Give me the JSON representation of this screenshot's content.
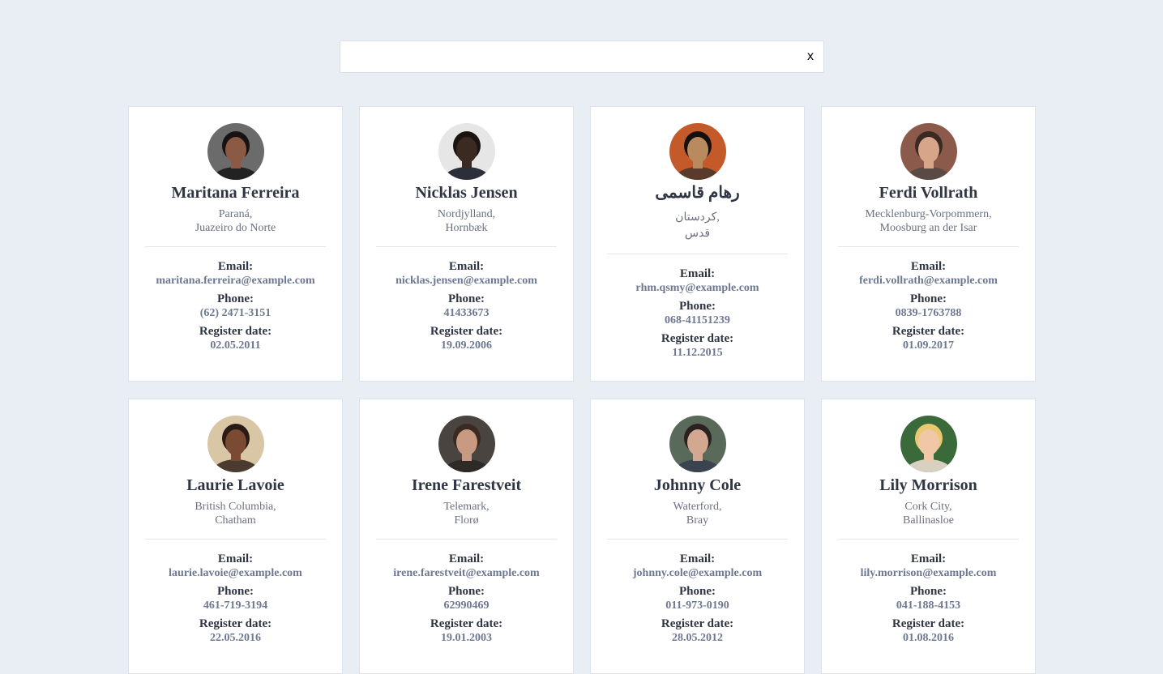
{
  "search": {
    "placeholder": "",
    "value": "",
    "clear_label": "x"
  },
  "labels": {
    "email": "Email:",
    "phone": "Phone:",
    "register": "Register date:"
  },
  "users": [
    {
      "name": "Maritana Ferreira",
      "state": "Paraná,",
      "city": "Juazeiro do Norte",
      "email": "maritana.ferreira@example.com",
      "phone": "(62) 2471-3151",
      "registered": "02.05.2011",
      "avatar": {
        "bg": "#6b6b6b",
        "skin": "#8a5a44",
        "hair": "#1a1212",
        "shirt": "#222222"
      }
    },
    {
      "name": "Nicklas Jensen",
      "state": "Nordjylland,",
      "city": "Hornbæk",
      "email": "nicklas.jensen@example.com",
      "phone": "41433673",
      "registered": "19.09.2006",
      "avatar": {
        "bg": "#e6e6e6",
        "skin": "#3b2a22",
        "hair": "#1c1410",
        "shirt": "#2a2f3a"
      }
    },
    {
      "name": "رهام قاسمی",
      "state": "کردستان,",
      "city": "قدس",
      "email": "rhm.qsmy@example.com",
      "phone": "068-41151239",
      "registered": "11.12.2015",
      "avatar": {
        "bg": "#c45a2a",
        "skin": "#b98a5e",
        "hair": "#141010",
        "shirt": "#5a3a2a"
      }
    },
    {
      "name": "Ferdi Vollrath",
      "state": "Mecklenburg-Vorpommern,",
      "city": "Moosburg an der Isar",
      "email": "ferdi.vollrath@example.com",
      "phone": "0839-1763788",
      "registered": "01.09.2017",
      "avatar": {
        "bg": "#8c5a4a",
        "skin": "#d6a58a",
        "hair": "#3a2a22",
        "shirt": "#5a4a44"
      }
    },
    {
      "name": "Laurie Lavoie",
      "state": "British Columbia,",
      "city": "Chatham",
      "email": "laurie.lavoie@example.com",
      "phone": "461-719-3194",
      "registered": "22.05.2016",
      "avatar": {
        "bg": "#d9c6a4",
        "skin": "#7a4a32",
        "hair": "#2a1a14",
        "shirt": "#4a3a30"
      }
    },
    {
      "name": "Irene Farestveit",
      "state": "Telemark,",
      "city": "Florø",
      "email": "irene.farestveit@example.com",
      "phone": "62990469",
      "registered": "19.01.2003",
      "avatar": {
        "bg": "#4a4440",
        "skin": "#c89a82",
        "hair": "#3a2a22",
        "shirt": "#2e2a28"
      }
    },
    {
      "name": "Johnny Cole",
      "state": "Waterford,",
      "city": "Bray",
      "email": "johnny.cole@example.com",
      "phone": "011-973-0190",
      "registered": "28.05.2012",
      "avatar": {
        "bg": "#5a6a5a",
        "skin": "#d2a890",
        "hair": "#2a2220",
        "shirt": "#3a4450"
      }
    },
    {
      "name": "Lily Morrison",
      "state": "Cork City,",
      "city": "Ballinasloe",
      "email": "lily.morrison@example.com",
      "phone": "041-188-4153",
      "registered": "01.08.2016",
      "avatar": {
        "bg": "#3a6a3a",
        "skin": "#f0c8a8",
        "hair": "#e8c870",
        "shirt": "#d8d0c0"
      }
    }
  ]
}
